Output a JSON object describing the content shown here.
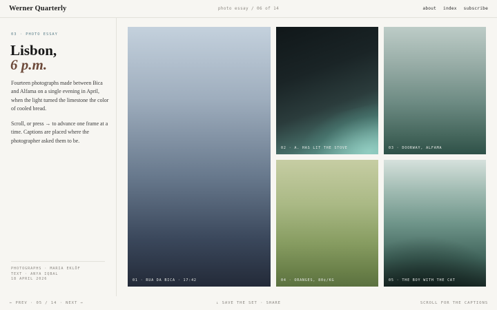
{
  "header": {
    "brand": "Werner Quarterly",
    "counter": "photo essay / 06 of 14",
    "nav": [
      "about",
      "index",
      "subscribe"
    ]
  },
  "sidebar": {
    "kicker": "03 · PHOTO ESSAY",
    "title_line1": "Lisbon,",
    "title_line2": "6 p.m.",
    "paragraph1": "Fourteen photographs made between Bica and Alfama on a single evening in April, when the light turned the limestone the color of cooled bread.",
    "paragraph2": "Scroll, or press → to advance one frame at a time. Captions are placed where the photographer asked them to be.",
    "credits": [
      "PHOTOGRAPHS · MARIA EKLÖF",
      "TEXT · ANYA IQBAL",
      "18 APRIL 2026"
    ]
  },
  "photos": [
    {
      "caption": "01 · RUA DA BICA · 17:42"
    },
    {
      "caption": "02 · A. HAS LIT THE STOVE"
    },
    {
      "caption": "03 · DOORWAY, ALFAMA"
    },
    {
      "caption": "04 · ORANGES, 80¢/KG"
    },
    {
      "caption": "05 · THE BOY WITH THE CAT"
    }
  ],
  "footer": {
    "prev": "← PREV",
    "position": "05 / 14",
    "next": "NEXT →",
    "save": "↓ SAVE THE SET",
    "share": "SHARE",
    "right": "SCROLL FOR THE CAPTIONS"
  }
}
